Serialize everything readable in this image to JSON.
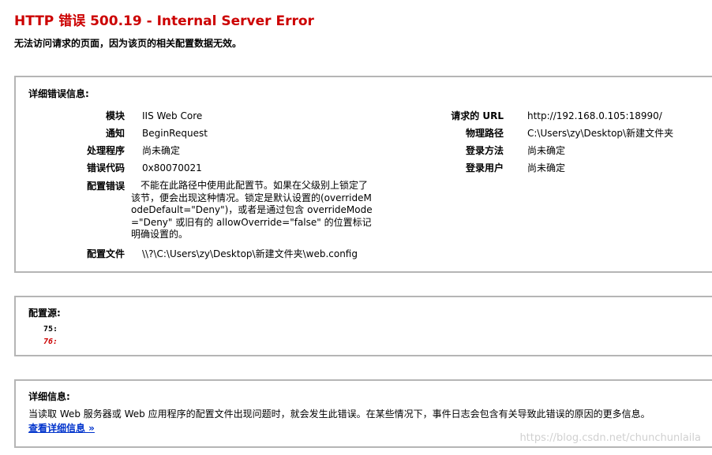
{
  "header": {
    "title": "HTTP 错误 500.19 - Internal Server Error",
    "subtitle": "无法访问请求的页面，因为该页的相关配置数据无效。"
  },
  "detailed_error": {
    "heading": "详细错误信息:",
    "left": [
      {
        "label": "模块",
        "value": "IIS Web Core"
      },
      {
        "label": "通知",
        "value": "BeginRequest"
      },
      {
        "label": "处理程序",
        "value": "尚未确定"
      },
      {
        "label": "错误代码",
        "value": "0x80070021"
      }
    ],
    "config_error_label": "配置错误",
    "config_error_value": "不能在此路径中使用此配置节。如果在父级别上锁定了该节，便会出现这种情况。锁定是默认设置的(overrideModeDefault=\"Deny\")，或者是通过包含 overrideMode=\"Deny\" 或旧有的 allowOverride=\"false\" 的位置标记明确设置的。",
    "config_file_label": "配置文件",
    "config_file_value": "\\\\?\\C:\\Users\\zy\\Desktop\\新建文件夹\\web.config",
    "right": [
      {
        "label": "请求的 URL",
        "value": "http://192.168.0.105:18990/"
      },
      {
        "label": "物理路径",
        "value": "C:\\Users\\zy\\Desktop\\新建文件夹"
      },
      {
        "label": "登录方法",
        "value": "尚未确定"
      },
      {
        "label": "登录用户",
        "value": "尚未确定"
      }
    ]
  },
  "config_source": {
    "heading": "配置源:",
    "lines": [
      "75:",
      "76:"
    ]
  },
  "more_info": {
    "heading": "详细信息:",
    "text": "当读取 Web 服务器或 Web 应用程序的配置文件出现问题时，就会发生此错误。在某些情况下，事件日志会包含有关导致此错误的原因的更多信息。",
    "link_label": "查看详细信息 »"
  },
  "watermark": "https://blog.csdn.net/chunchunlaila",
  "colors": {
    "title": "#cc0000",
    "link": "#0033cc",
    "border": "#b5b5b5"
  }
}
